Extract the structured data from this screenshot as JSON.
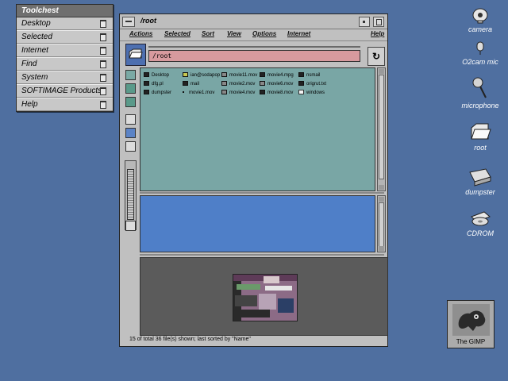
{
  "toolchest": {
    "title": "Toolchest",
    "items": [
      "Desktop",
      "Selected",
      "Internet",
      "Find",
      "System",
      "SOFTIMAGE Products",
      "Help"
    ]
  },
  "file_manager": {
    "title": "/root",
    "menu": [
      "Actions",
      "Selected",
      "Sort",
      "View",
      "Options",
      "Internet",
      "Help"
    ],
    "path": "/root",
    "files": [
      {
        "name": "Desktop",
        "icon": "folder-icon"
      },
      {
        "name": "dfg.pl",
        "icon": "script-icon"
      },
      {
        "name": "dumpster",
        "icon": "trash-icon"
      },
      {
        "name": "ian@sodapop",
        "icon": "host-icon"
      },
      {
        "name": "mail",
        "icon": "folder-icon"
      },
      {
        "name": "movie1.mov",
        "icon": "bullet-icon"
      },
      {
        "name": "movie11.mov",
        "icon": "movie-icon"
      },
      {
        "name": "movie2.mov",
        "icon": "movie-icon"
      },
      {
        "name": "movie4.mov",
        "icon": "movie-icon"
      },
      {
        "name": "movie4.mpg",
        "icon": "mpeg-icon"
      },
      {
        "name": "movie6.mov",
        "icon": "movie-icon"
      },
      {
        "name": "movie8.mov",
        "icon": "movie-icon"
      },
      {
        "name": "nsmail",
        "icon": "folder-icon"
      },
      {
        "name": "origrut.txt",
        "icon": "text-icon"
      },
      {
        "name": "windows",
        "icon": "doc-icon"
      }
    ],
    "status": "15 of total 36 file(s) shown; last sorted by \"Name\""
  },
  "desktop_icons": [
    {
      "label": "camera",
      "icon": "camera-icon"
    },
    {
      "label": "O2cam mic",
      "icon": "microphone-icon"
    },
    {
      "label": "microphone",
      "icon": "microphone-icon"
    },
    {
      "label": "root",
      "icon": "folder-icon"
    },
    {
      "label": "dumpster",
      "icon": "trash-icon"
    },
    {
      "label": "CDROM",
      "icon": "cdrom-icon"
    }
  ],
  "gimp": {
    "label": "The GIMP",
    "icon": "gimp-icon"
  },
  "colors": {
    "desktop": "#4f6fa0",
    "file_area": "#79a6a5",
    "path_field": "#d79a9e",
    "blue_pane": "#4f7fc8",
    "preview": "#5b5b5b"
  }
}
